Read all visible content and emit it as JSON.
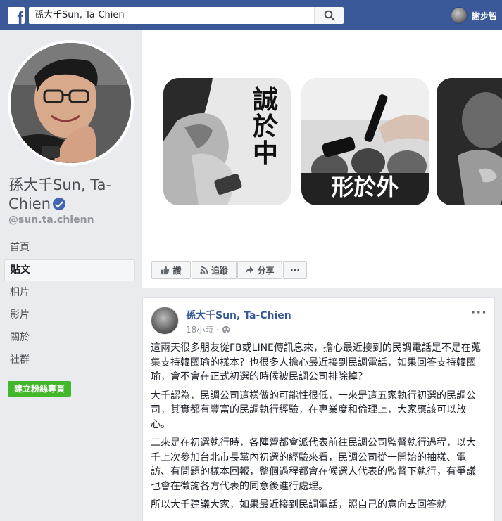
{
  "topbar": {
    "logo_letter": "f",
    "search_value": "孫大千Sun, Ta-Chien",
    "user_name": "謝步智"
  },
  "profile": {
    "name": "孫大千Sun, Ta-Chien",
    "username": "@sun.ta.chienn"
  },
  "nav": {
    "items": [
      "首頁",
      "貼文",
      "相片",
      "影片",
      "關於",
      "社群"
    ],
    "active_index": 1
  },
  "create_page_button": "建立粉絲專頁",
  "cover": {
    "tile1_text": "誠於中",
    "tile2_text": "形於外"
  },
  "actions": {
    "like": "讚",
    "follow": "追蹤",
    "share": "分享",
    "more": "···"
  },
  "post": {
    "author": "孫大千Sun, Ta-Chien",
    "time": "18小時",
    "more": "···",
    "paragraphs": [
      "這兩天很多朋友從FB或LINE傳訊息來，擔心最近接到的民調電話是不是在蒐集支持韓國瑜的樣本？也很多人擔心最近接到民調電話，如果回答支持韓國瑜，會不會在正式初選的時候被民調公司排除掉？",
      "大千認為，民調公司這樣做的可能性很低，一來是這五家執行初選的民調公司，其實都有豐富的民調執行經驗，在專業度和倫理上，大家應該可以放心。",
      "二來是在初選執行時，各陣營都會派代表前往民調公司監督執行過程，以大千上次參加台北市長黨內初選的經驗來看，民調公司從一開始的抽樣、電訪、有問題的樣本回報，整個過程都會在候選人代表的監督下執行，有爭議也會在徵詢各方代表的同意後進行處理。",
      "所以大千建議大家，如果最近接到民調電話，照自己的意向去回答就"
    ]
  },
  "colors": {
    "brand_blue": "#3b5998",
    "link_blue": "#365899",
    "green": "#42b72a",
    "background": "#e9ebee",
    "verified_blue": "#4267b2"
  },
  "icons": [
    "search-icon",
    "verified-icon",
    "like-icon",
    "rss-icon",
    "share-icon",
    "globe-icon"
  ]
}
